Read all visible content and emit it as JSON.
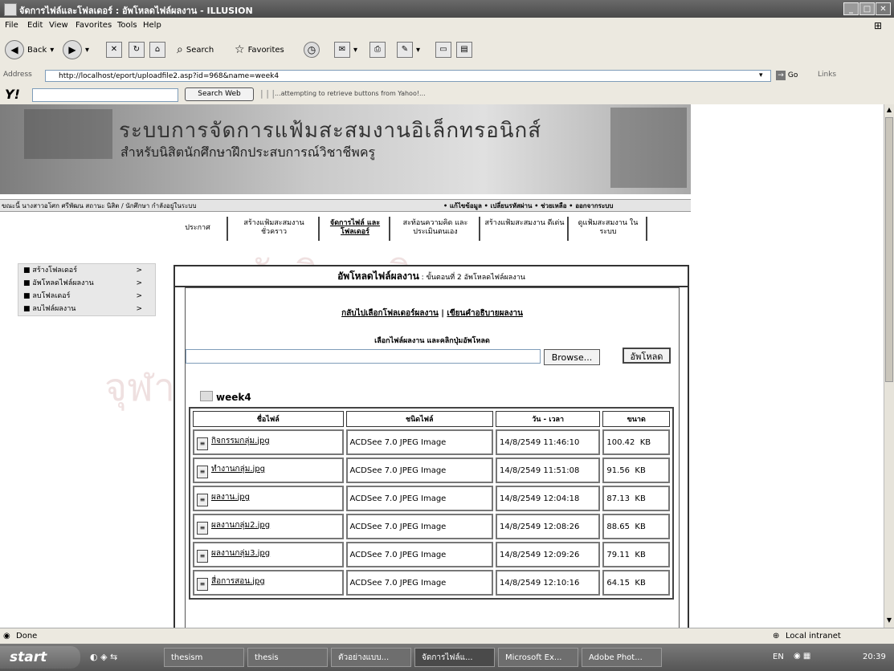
{
  "window": {
    "title": "จัดการไฟล์และโฟลเดอร์ : อัพโหลดไฟล์ผลงาน - ILLUSION"
  },
  "menu": [
    "File",
    "Edit",
    "View",
    "Favorites",
    "Tools",
    "Help"
  ],
  "toolbar": {
    "back": "Back",
    "search": "Search",
    "favorites": "Favorites"
  },
  "address": {
    "label": "Address",
    "url": "http://localhost/eport/uploadfile2.asp?id=968&name=week4",
    "go": "Go",
    "links": "Links"
  },
  "yahoo": {
    "logo": "Y!",
    "search_button": "Search Web",
    "status": "...attempting to retrieve buttons from Yahoo!..."
  },
  "site": {
    "title_line1": "ระบบการจัดการแฟ้มสะสมงานอิเล็กทรอนิกส์",
    "title_line2": "สำหรับนิสิตนักศึกษาฝึกประสบการณ์วิชาชีพครู",
    "user_strip": "ขณะนี้ นางสาวอโศก ศรีพัฒน สถานะ นิสิต / นักศึกษา กำลังอยู่ในระบบ",
    "right_strip": "• แก้ไขข้อมูล • เปลี่ยนรหัสผ่าน • ช่วยเหลือ • ออกจากระบบ",
    "tabs": [
      "ประกาศ",
      "สร้างแฟ้มสะสมงาน ชั่วคราว",
      "จัดการไฟล์ และโฟลเดอร์",
      "สะท้อนความคิด และประเมินตนเอง",
      "สร้างแฟ้มสะสมงาน ดีเด่น",
      "ดูแฟ้มสะสมงาน ในระบบ"
    ],
    "sidebar": [
      {
        "label": "สร้างโฟลเดอร์",
        "arrow": ">"
      },
      {
        "label": "อัพโหลดไฟล์ผลงาน",
        "arrow": ">"
      },
      {
        "label": "ลบโฟลเดอร์",
        "arrow": ">"
      },
      {
        "label": "ลบไฟล์ผลงาน",
        "arrow": ">"
      }
    ]
  },
  "panel": {
    "title": "อัพโหลดไฟล์ผลงาน",
    "subtitle": " : ขั้นตอนที่ 2 อัพโหลดไฟล์ผลงาน",
    "link_back": "กลับไปเลือกโฟลเดอร์ผลงาน",
    "link_sep": " | ",
    "link_desc": "เขียนคำอธิบายผลงาน",
    "pick_label": "เลือกไฟล์ผลงาน และคลิกปุ่มอัพโหลด",
    "browse": "Browse...",
    "upload": "อัพโหลด",
    "folder": "week4"
  },
  "table": {
    "headers": [
      "ชื่อไฟล์",
      "ชนิดไฟล์",
      "วัน - เวลา",
      "ขนาด"
    ],
    "rows": [
      {
        "name": "กิจกรรมกลุ่ม.jpg",
        "type": "ACDSee 7.0 JPEG Image",
        "date": "14/8/2549 11:46:10",
        "size": "100.42",
        "unit": "KB"
      },
      {
        "name": "ทำงานกลุ่ม.jpg",
        "type": "ACDSee 7.0 JPEG Image",
        "date": "14/8/2549 11:51:08",
        "size": "91.56",
        "unit": "KB"
      },
      {
        "name": "ผลงาน.jpg",
        "type": "ACDSee 7.0 JPEG Image",
        "date": "14/8/2549 12:04:18",
        "size": "87.13",
        "unit": "KB"
      },
      {
        "name": "ผลงานกลุ่ม2.jpg",
        "type": "ACDSee 7.0 JPEG Image",
        "date": "14/8/2549 12:08:26",
        "size": "88.65",
        "unit": "KB"
      },
      {
        "name": "ผลงานกลุ่ม3.jpg",
        "type": "ACDSee 7.0 JPEG Image",
        "date": "14/8/2549 12:09:26",
        "size": "79.11",
        "unit": "KB"
      },
      {
        "name": "สื่อการสอน.jpg",
        "type": "ACDSee 7.0 JPEG Image",
        "date": "14/8/2549 12:10:16",
        "size": "64.15",
        "unit": "KB"
      }
    ]
  },
  "watermark": {
    "line1": "สถาบันวิทยบริการ",
    "line2": "จุฬาลงกรณ์มหาวิทยาลัย"
  },
  "status": {
    "left": "Done",
    "right": "Local intranet"
  },
  "taskbar": {
    "start": "start",
    "tasks": [
      "thesism",
      "thesis",
      "ตัวอย่างแบบ...",
      "จัดการไฟล์แ...",
      "Microsoft Ex...",
      "Adobe Phot..."
    ],
    "lang": "EN",
    "clock": "20:39"
  }
}
